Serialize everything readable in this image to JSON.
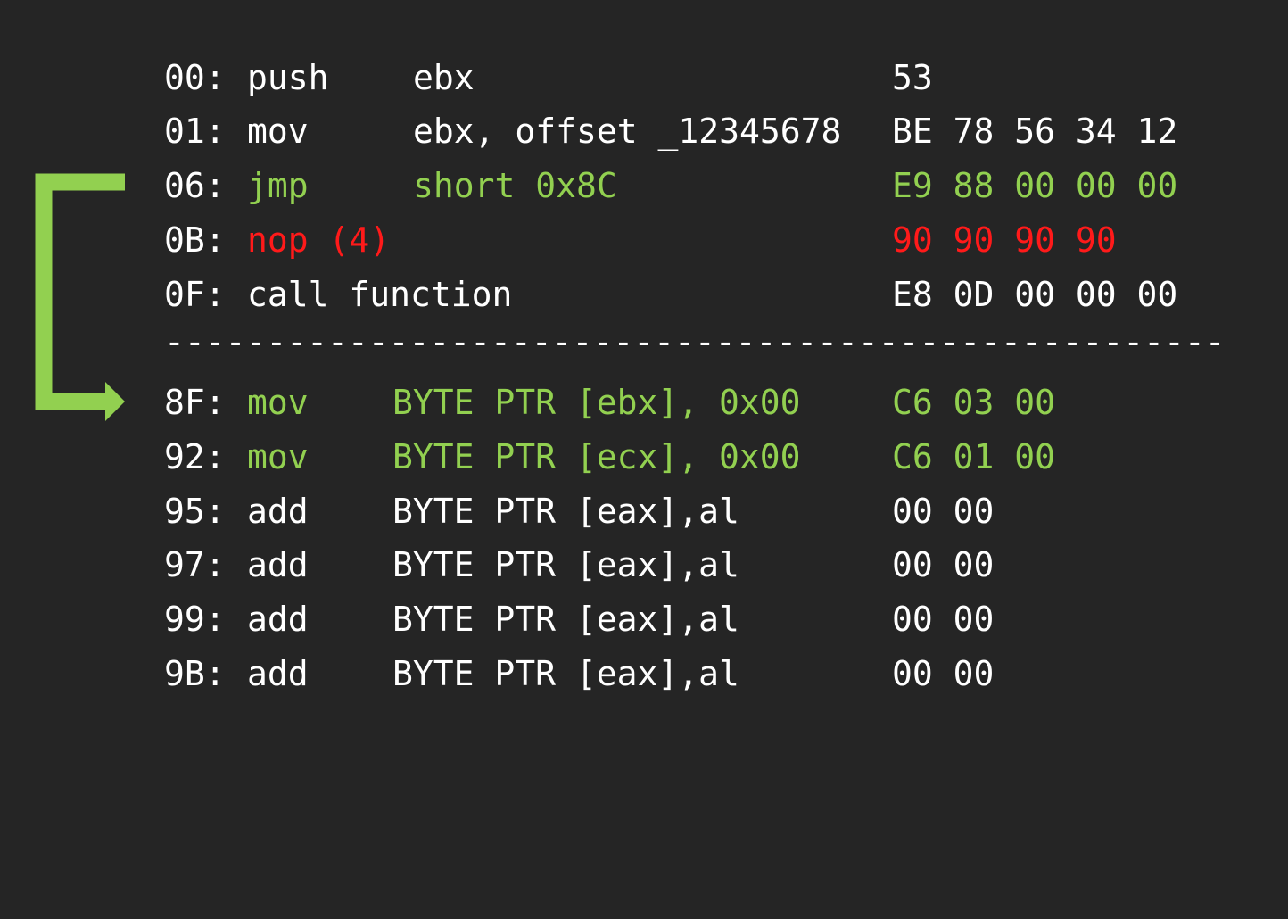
{
  "colors": {
    "background": "#252525",
    "text": "#ffffff",
    "highlight_green": "#92d050",
    "highlight_red": "#ff1a1a"
  },
  "rows_top": [
    {
      "addr": "00:",
      "mnemonic": "push",
      "operand": "ebx",
      "bytes": "53",
      "color": "white"
    },
    {
      "addr": "01:",
      "mnemonic": "mov",
      "operand": "ebx, offset _12345678",
      "bytes": "BE 78 56 34 12",
      "color": "white"
    },
    {
      "addr": "06:",
      "mnemonic": "jmp",
      "operand": "short 0x8C",
      "bytes": "E9 88 00 00 00",
      "color": "green"
    },
    {
      "addr": "0B:",
      "mnemonic": "nop (4)",
      "operand": "",
      "bytes": "90 90 90 90",
      "color": "red"
    },
    {
      "addr": "0F:",
      "mnemonic": "call function",
      "operand": "",
      "bytes": "E8 0D 00 00 00",
      "color": "white"
    }
  ],
  "divider": "----------------------------------------------------",
  "rows_bottom": [
    {
      "addr": "8F:",
      "mnemonic": "mov",
      "operand": "BYTE PTR [ebx], 0x00",
      "bytes": "C6 03 00",
      "color": "green"
    },
    {
      "addr": "92:",
      "mnemonic": "mov",
      "operand": "BYTE PTR [ecx], 0x00",
      "bytes": "C6 01 00",
      "color": "green"
    },
    {
      "addr": "95:",
      "mnemonic": "add",
      "operand": "BYTE PTR [eax],al",
      "bytes": "00 00",
      "color": "white"
    },
    {
      "addr": "97:",
      "mnemonic": "add",
      "operand": "BYTE PTR [eax],al",
      "bytes": "00 00",
      "color": "white"
    },
    {
      "addr": "99:",
      "mnemonic": "add",
      "operand": "BYTE PTR [eax],al",
      "bytes": "00 00",
      "color": "white"
    },
    {
      "addr": "9B:",
      "mnemonic": "add",
      "operand": "BYTE PTR [eax],al",
      "bytes": "00 00",
      "color": "white"
    }
  ],
  "jump_arrow": {
    "from": "06:",
    "to": "8F:",
    "color": "#92d050"
  }
}
